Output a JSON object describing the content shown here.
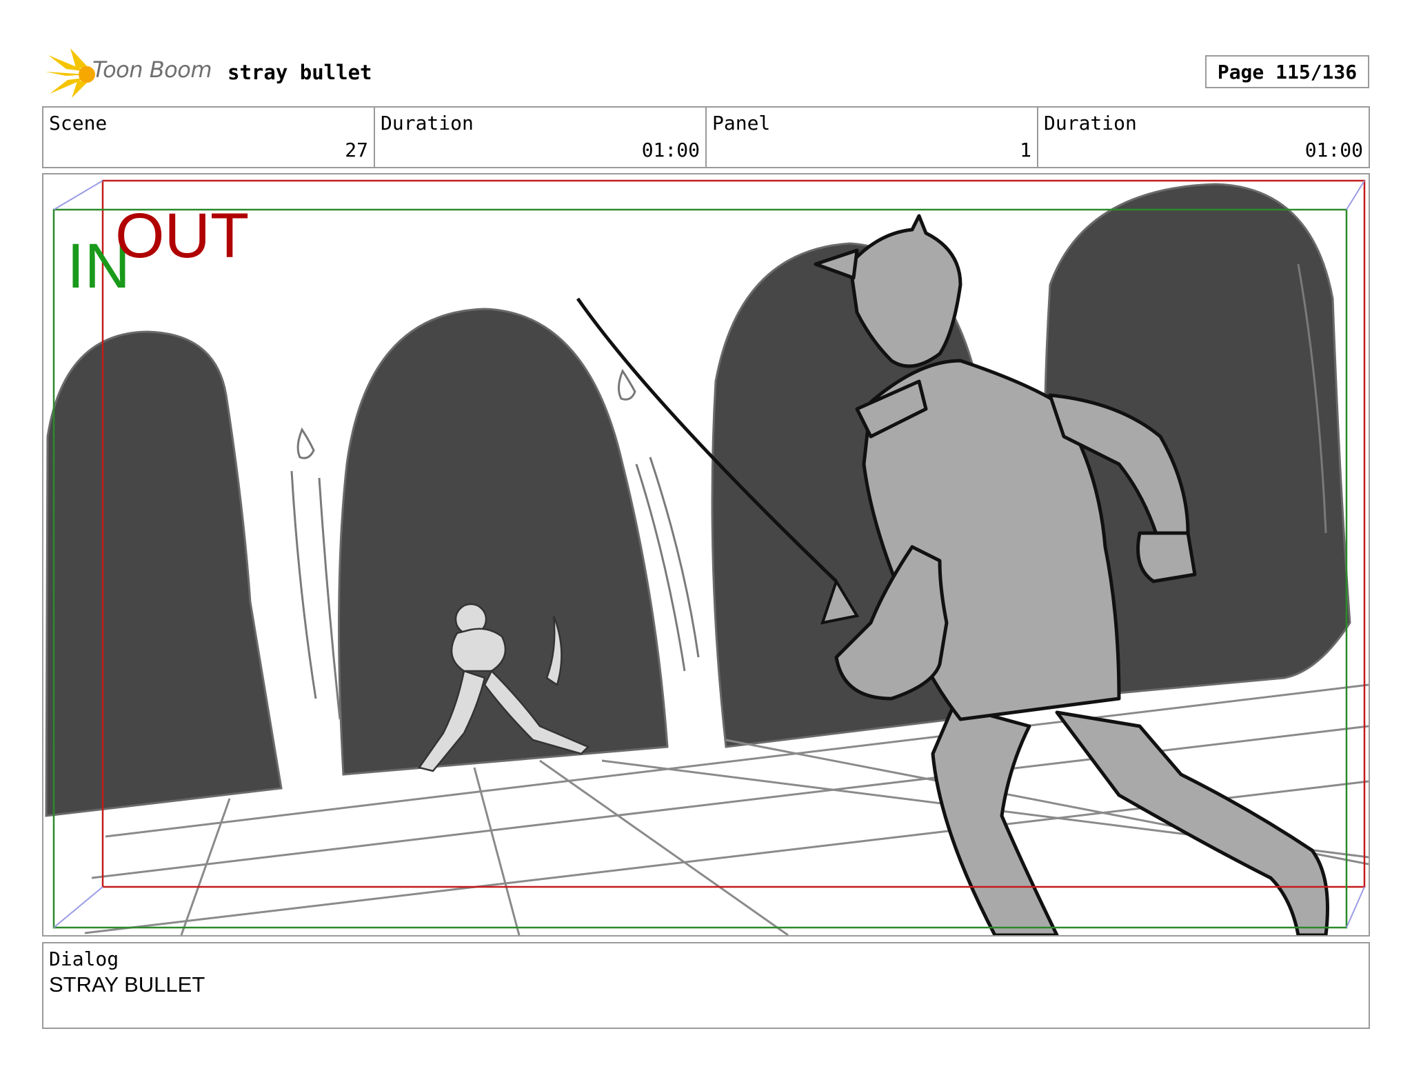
{
  "header": {
    "logo_text": "Toon Boom",
    "project_title": "stray bullet",
    "page_label": "Page 115/136"
  },
  "info": {
    "scene_label": "Scene",
    "scene_value": "27",
    "scene_duration_label": "Duration",
    "scene_duration_value": "01:00",
    "panel_label": "Panel",
    "panel_value": "1",
    "panel_duration_label": "Duration",
    "panel_duration_value": "01:00"
  },
  "frame_markers": {
    "in_label": "IN",
    "out_label": "OUT",
    "in_color": "#1a9a1a",
    "out_color": "#b00000"
  },
  "dialog": {
    "label": "Dialog",
    "text": "STRAY BULLET"
  }
}
